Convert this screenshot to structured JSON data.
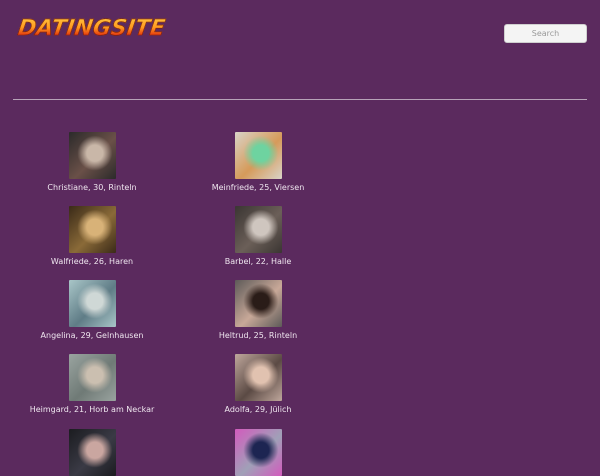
{
  "header": {
    "logo_text": "DATINGSITE",
    "search_placeholder": "Search"
  },
  "profiles": [
    {
      "caption": "Christiane, 30, Rinteln",
      "colors": [
        "#2b2a2a",
        "#c9b7a8",
        "#6a5048"
      ]
    },
    {
      "caption": "Meinfriede, 25, Viersen",
      "colors": [
        "#d9d4c8",
        "#6ed3a0",
        "#d69a5a"
      ]
    },
    {
      "caption": "Walfriede, 26, Haren",
      "colors": [
        "#3a2a18",
        "#d8b278",
        "#8a6a38"
      ]
    },
    {
      "caption": "Barbel, 22, Halle",
      "colors": [
        "#3a3532",
        "#cfc6bf",
        "#6b5f58"
      ]
    },
    {
      "caption": "Angelina, 29, Gelnhausen",
      "colors": [
        "#a9c6c8",
        "#cfd8d6",
        "#5f7c86"
      ]
    },
    {
      "caption": "Heltrud, 25, Rinteln",
      "colors": [
        "#5d5a58",
        "#2a1c18",
        "#c8a898"
      ]
    },
    {
      "caption": "Heimgard, 21, Horb am Neckar",
      "colors": [
        "#9aa4a0",
        "#cbbfb0",
        "#6f7a76"
      ]
    },
    {
      "caption": "Adolfa, 29, Jülich",
      "colors": [
        "#bfa79c",
        "#e1c2b0",
        "#5b4a44"
      ]
    },
    {
      "caption": "",
      "colors": [
        "#1b1c20",
        "#caa6a0",
        "#3a3a45"
      ]
    },
    {
      "caption": "",
      "colors": [
        "#d25bbd",
        "#1d2552",
        "#a0a0b8"
      ]
    }
  ]
}
